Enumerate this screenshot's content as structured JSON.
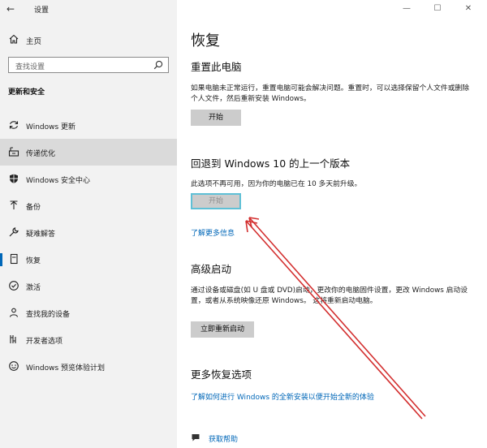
{
  "window": {
    "title": "设置",
    "controls": {
      "minimize": "—",
      "maximize": "☐",
      "close": "✕"
    }
  },
  "sidebar": {
    "home_label": "主页",
    "search_placeholder": "查找设置",
    "section_title": "更新和安全",
    "items": [
      {
        "label": "Windows 更新",
        "icon": "sync-icon"
      },
      {
        "label": "传递优化",
        "icon": "delivery-optimization-icon"
      },
      {
        "label": "Windows 安全中心",
        "icon": "shield-icon"
      },
      {
        "label": "备份",
        "icon": "backup-arrow-icon"
      },
      {
        "label": "疑难解答",
        "icon": "wrench-icon"
      },
      {
        "label": "恢复",
        "icon": "recovery-icon"
      },
      {
        "label": "激活",
        "icon": "check-circle-icon"
      },
      {
        "label": "查找我的设备",
        "icon": "person-pin-icon"
      },
      {
        "label": "开发者选项",
        "icon": "developer-icon"
      },
      {
        "label": "Windows 预览体验计划",
        "icon": "smiley-icon"
      }
    ]
  },
  "main": {
    "title": "恢复",
    "reset": {
      "heading": "重置此电脑",
      "description": "如果电脑未正常运行，重置电脑可能会解决问题。重置时，可以选择保留个人文件或删除个人文件，然后重新安装 Windows。",
      "button": "开始"
    },
    "rollback": {
      "heading": "回退到 Windows 10 的上一个版本",
      "description": "此选项不再可用，因为你的电脑已在 10 多天前升级。",
      "button": "开始",
      "link": "了解更多信息"
    },
    "advanced": {
      "heading": "高级启动",
      "description": "通过设备或磁盘(如 U 盘或 DVD)启动，更改你的电脑固件设置，更改 Windows 启动设置，或者从系统映像还原 Windows。 这将重新启动电脑。",
      "button": "立即重新启动"
    },
    "more": {
      "heading": "更多恢复选项",
      "link": "了解如何进行 Windows 的全新安装以便开始全新的体验"
    },
    "help": {
      "label": "获取帮助"
    }
  },
  "colors": {
    "accent": "#0067b8",
    "annotation": "#d32f2f",
    "focus": "#5fc0d6"
  }
}
